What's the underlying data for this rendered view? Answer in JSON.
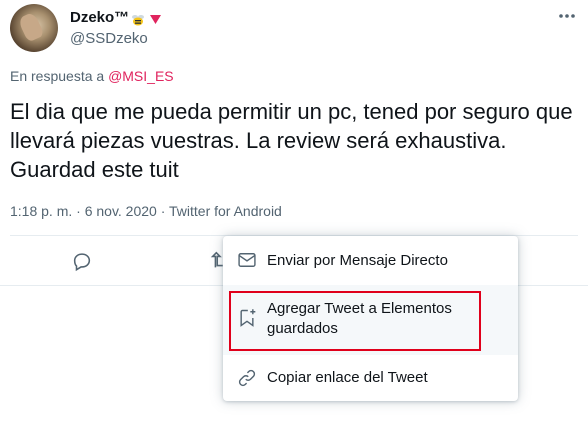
{
  "author": {
    "name": "Dzeko™",
    "handle": "@SSDzeko"
  },
  "reply": {
    "prefix": "En respuesta a ",
    "mention": "@MSI_ES"
  },
  "tweet": {
    "text": "El dia que me pueda permitir un pc, tened por seguro que llevará piezas vuestras. La review será exhaustiva. Guardad este tuit",
    "meta": "1:18 p. m. · 6 nov. 2020 · Twitter for Android"
  },
  "menu": {
    "items": [
      {
        "label": "Enviar por Mensaje Directo",
        "icon": "envelope-icon"
      },
      {
        "label": "Agregar Tweet a Elementos guardados",
        "icon": "bookmark-add-icon"
      },
      {
        "label": "Copiar enlace del Tweet",
        "icon": "link-icon"
      }
    ]
  },
  "colors": {
    "accent_pink": "#e0245e",
    "highlight_red": "#e0001b",
    "secondary_text": "#536471",
    "primary_text": "#0f1419"
  }
}
